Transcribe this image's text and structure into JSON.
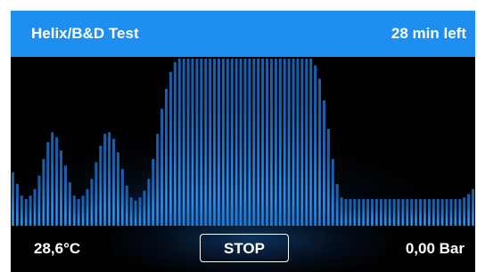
{
  "header": {
    "title": "Helix/B&D Test",
    "time_left": "28 min left"
  },
  "footer": {
    "temperature": "28,6°C",
    "stop_label": "STOP",
    "pressure": "0,00 Bar"
  },
  "colors": {
    "header_bg": "#1e8ff0",
    "bar_color": "#1e7fd8",
    "background": "#000000",
    "text": "#ffffff"
  },
  "chart_data": {
    "type": "bar",
    "values": [
      0.32,
      0.25,
      0.18,
      0.16,
      0.18,
      0.22,
      0.3,
      0.4,
      0.5,
      0.56,
      0.53,
      0.45,
      0.36,
      0.26,
      0.18,
      0.16,
      0.18,
      0.22,
      0.28,
      0.38,
      0.48,
      0.55,
      0.56,
      0.52,
      0.44,
      0.34,
      0.24,
      0.17,
      0.15,
      0.17,
      0.21,
      0.28,
      0.4,
      0.55,
      0.7,
      0.82,
      0.92,
      0.98,
      1.0,
      1.0,
      1.0,
      1.0,
      1.0,
      1.0,
      1.0,
      1.0,
      1.0,
      1.0,
      1.0,
      1.0,
      1.0,
      1.0,
      1.0,
      1.0,
      1.0,
      1.0,
      1.0,
      1.0,
      1.0,
      1.0,
      1.0,
      1.0,
      1.0,
      1.0,
      1.0,
      1.0,
      1.0,
      1.0,
      1.0,
      0.96,
      0.88,
      0.75,
      0.58,
      0.4,
      0.25,
      0.17,
      0.16,
      0.16,
      0.16,
      0.16,
      0.16,
      0.16,
      0.16,
      0.16,
      0.16,
      0.16,
      0.16,
      0.16,
      0.16,
      0.16,
      0.16,
      0.16,
      0.16,
      0.16,
      0.16,
      0.16,
      0.16,
      0.16,
      0.16,
      0.16,
      0.16,
      0.16,
      0.16,
      0.17,
      0.19,
      0.22
    ],
    "ylim": [
      0,
      1
    ],
    "grid": false,
    "legend": "none"
  }
}
